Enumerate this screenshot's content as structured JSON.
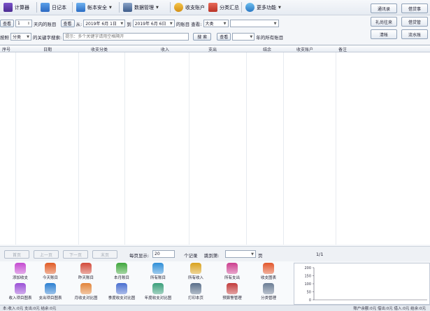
{
  "toolbar": {
    "calculator": "计算器",
    "diary": "日记本",
    "security": "帐本安全",
    "data_mgmt": "数据管理",
    "accounts": "收支账户",
    "category_summary": "分类汇总",
    "more": "更多功能"
  },
  "right_buttons": [
    "通讯录",
    "借贷事",
    "礼尚往来",
    "借贷管",
    "清帐",
    "流水账"
  ],
  "filter_row1": {
    "view_button": "查看",
    "days_value": "1",
    "days_label": "天内的账目",
    "view_button2": "查看",
    "from_label": "从:",
    "from_date": "2019年 6月 1日",
    "to_label": "到",
    "to_date": "2019年 6月 6日",
    "category_label": "的账目 查看:",
    "category_value": "大类",
    "sub_value": ""
  },
  "filter_row2": {
    "by_label": "按照",
    "by_value": "分类",
    "keyword_label": "的关键字搜索:",
    "keyword_placeholder": "提示：多个关键字请用空格隔开",
    "search_button": "搜  索",
    "view_button": "查看",
    "year_label": "年的所有账目"
  },
  "grid": {
    "columns": [
      "序号",
      "日期",
      "收支分类",
      "收入",
      "支出",
      "结余",
      "收支账户",
      "备注"
    ]
  },
  "pager": {
    "first": "首页",
    "prev": "上一页",
    "next": "下一页",
    "last": "末页",
    "per_page_label": "每页显示:",
    "per_page_value": "20",
    "records_label": "个记录",
    "jump_label": "跳到第:",
    "page_label": "页",
    "page_indicator": "1/1"
  },
  "features": [
    {
      "label": "添加收支",
      "color": "#c44ad1",
      "icon": "add-icon"
    },
    {
      "label": "今天账目",
      "color": "#e05a24",
      "icon": "today-icon"
    },
    {
      "label": "昨天账目",
      "color": "#d24a3a",
      "icon": "yesterday-icon"
    },
    {
      "label": "本月账目",
      "color": "#3fa73c",
      "icon": "month-icon"
    },
    {
      "label": "所有账目",
      "color": "#2f8fd8",
      "icon": "all-icon"
    },
    {
      "label": "所有收入",
      "color": "#d9a21e",
      "icon": "income-icon"
    },
    {
      "label": "所有支出",
      "color": "#cc3f8f",
      "icon": "expense-icon"
    },
    {
      "label": "收支图表",
      "color": "#e2572c",
      "icon": "chart-icon"
    },
    {
      "label": "收入项目图表",
      "color": "#9b4fd6",
      "icon": "income-chart-icon"
    },
    {
      "label": "支出项目图表",
      "color": "#2c7fd1",
      "icon": "expense-chart-icon"
    },
    {
      "label": "月收支对比图",
      "color": "#e2843a",
      "icon": "month-compare-icon"
    },
    {
      "label": "季度收支对比图",
      "color": "#4a6fd0",
      "icon": "quarter-compare-icon"
    },
    {
      "label": "年度收支对比图",
      "color": "#3a9f7a",
      "icon": "year-compare-icon"
    },
    {
      "label": "打印本页",
      "color": "#5a6f8a",
      "icon": "print-icon"
    },
    {
      "label": "预算警管理",
      "color": "#c23b3b",
      "icon": "budget-icon"
    },
    {
      "label": "分类管理",
      "color": "#6b7d95",
      "icon": "category-icon"
    }
  ],
  "mini_chart": {
    "ticks": [
      "200",
      "150",
      "100",
      "50",
      "0"
    ]
  },
  "status": {
    "left": "本:收入:0元  支出:0元  结余:0元",
    "right": "账户余额:0元  借出:0元  借入:0元  结余:0元"
  }
}
